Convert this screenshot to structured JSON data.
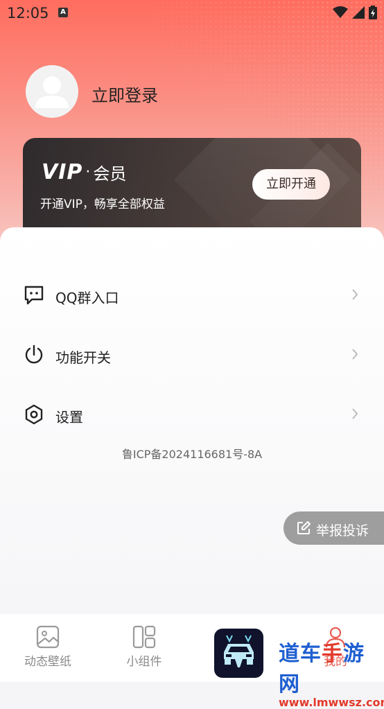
{
  "status_bar": {
    "time": "12:05",
    "a_badge": "A"
  },
  "profile": {
    "login_text": "立即登录"
  },
  "vip": {
    "logo": "VIP",
    "dot": "·",
    "member": "会员",
    "subtitle": "开通VIP，畅享全部权益",
    "button": "立即开通"
  },
  "menu": {
    "items": [
      {
        "label": "QQ群入口",
        "icon": "chat-bubble-icon"
      },
      {
        "label": "功能开关",
        "icon": "power-icon"
      },
      {
        "label": "设置",
        "icon": "hexagon-settings-icon"
      }
    ]
  },
  "icp": "鲁ICP备2024116681号-8A",
  "report": {
    "label": "举报投诉"
  },
  "tabs": [
    {
      "label": "动态壁纸",
      "icon": "image-icon"
    },
    {
      "label": "小组件",
      "icon": "widget-icon"
    },
    {
      "label": "我的",
      "icon": "profile-icon"
    }
  ],
  "watermark": {
    "line1_blue": "道车",
    "line1_red": "手",
    "line1_blue2": "游网",
    "line2": "www.lmwwsz.com"
  },
  "colors": {
    "header_red": "#ff6d5f",
    "vip_dark": "#2e2a2c",
    "watermark_blue": "#1f5fd1",
    "watermark_red": "#e23a2c"
  }
}
